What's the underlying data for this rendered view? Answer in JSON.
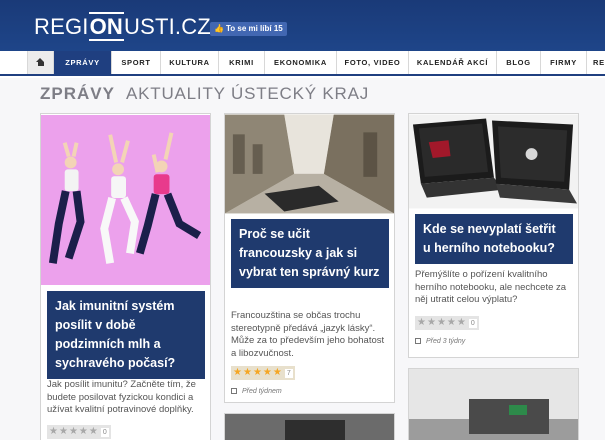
{
  "header": {
    "logo_left": "REGI",
    "logo_on": "ON",
    "logo_right": "USTI.CZ",
    "fb_like_label": "To se mi líbí 15"
  },
  "nav": {
    "items": [
      "ZPRÁVY",
      "SPORT",
      "KULTURA",
      "KRIMI",
      "EKONOMIKA",
      "FOTO, VIDEO",
      "KALENDÁŘ AKCÍ",
      "BLOG",
      "FIRMY",
      "RE"
    ]
  },
  "section": {
    "title": "ZPRÁVY",
    "subtitle": "AKTUALITY ÚSTECKÝ KRAJ"
  },
  "articles": [
    {
      "title": "Jak imunitní systém posílit v době podzimních mlh a sychravého počasí?",
      "perex": "Jak posílit imunitu? Začněte tím, že budete posilovat fyzickou kondici a užívat kvalitní potravinové doplňky.",
      "rating_stars": 5,
      "rating_count": "0",
      "date": ""
    },
    {
      "title": "Proč se učit francouzsky a jak si vybrat ten správný kurz",
      "perex": "Francouzština se občas trochu stereotypně předává „jazyk lásky“. Může za to především jeho bohatost a libozvučnost.",
      "rating_stars": 5,
      "rating_count": "7",
      "date": "Před týdnem"
    },
    {
      "title": "Kde se nevyplatí šetřit u herního notebooku?",
      "perex": "Přemýšlíte o pořízení kvalitního herního notebooku, ale nechcete za něj utratit celou výplatu?",
      "rating_stars": 5,
      "rating_count": "0",
      "date": "Před 3 týdny"
    }
  ],
  "colors": {
    "header_bg": "#1e4589",
    "nav_active": "#1f3f80",
    "card_title_bg": "#1f3a6e",
    "star_rated": "#f5a623"
  }
}
